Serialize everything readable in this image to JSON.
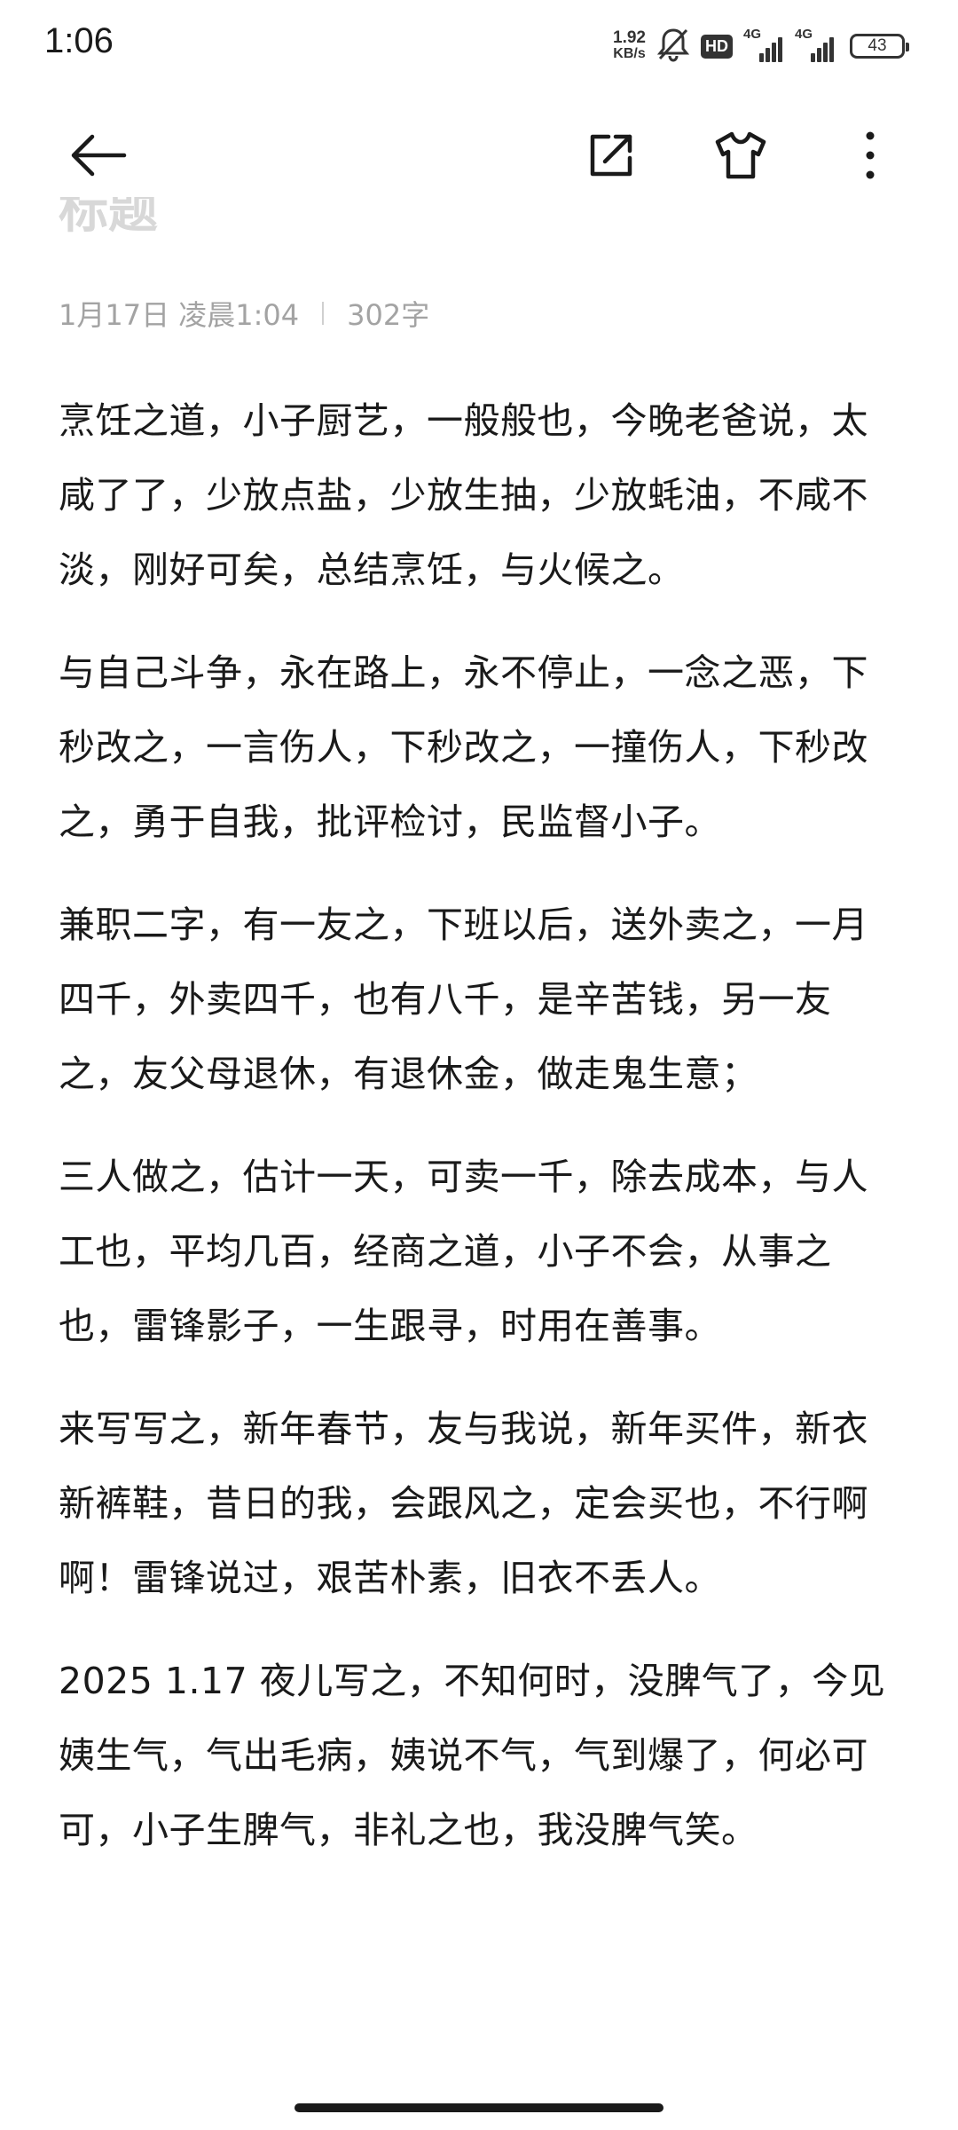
{
  "status_bar": {
    "time": "1:06",
    "net_speed_value": "1.92",
    "net_speed_unit": "KB/s",
    "hd_label": "HD",
    "signal1_label": "4G",
    "signal2_label": "4G",
    "battery": "43"
  },
  "app_bar": {
    "back_icon": "arrow-left-icon",
    "share_icon": "share-external-icon",
    "theme_icon": "shirt-icon",
    "more_icon": "more-vertical-icon"
  },
  "note": {
    "title": "标题",
    "date": "1月17日 凌晨1:04",
    "word_count": "302字",
    "paragraphs": [
      "烹饪之道，小子厨艺，一般般也，今晚老爸说，太咸了了，少放点盐，少放生抽，少放蚝油，不咸不淡，刚好可矣，总结烹饪，与火候之。",
      "与自己斗争，永在路上，永不停止，一念之恶，下秒改之，一言伤人，下秒改之，一撞伤人，下秒改之，勇于自我，批评检讨，民监督小子。",
      "兼职二字，有一友之，下班以后，送外卖之，一月四千，外卖四千，也有八千，是辛苦钱，另一友之，友父母退休，有退休金，做走鬼生意；",
      "三人做之，估计一天，可卖一千，除去成本，与人工也，平均几百，经商之道，小子不会，从事之也，雷锋影子，一生跟寻，时用在善事。",
      "来写写之，新年春节，友与我说，新年买件，新衣新裤鞋，昔日的我，会跟风之，定会买也，不行啊啊！雷锋说过，艰苦朴素，旧衣不丢人。",
      "2025 1.17 夜儿写之，不知何时，没脾气了，今见姨生气，气出毛病，姨说不气，气到爆了，何必可可，小子生脾气，非礼之也，我没脾气笑。"
    ]
  },
  "colors": {
    "text": "#1a1a1a",
    "meta": "#a3a3a3",
    "title_faded": "#d8d8d8",
    "background": "#ffffff"
  }
}
